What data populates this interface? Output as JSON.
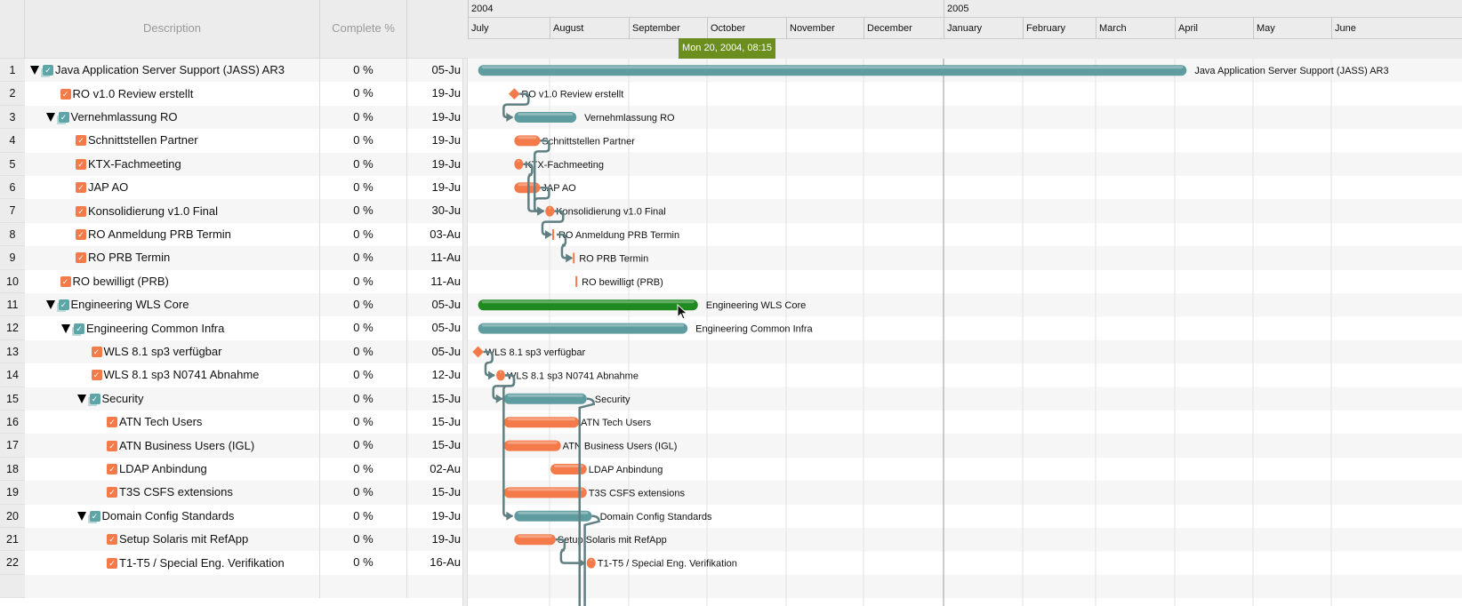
{
  "columns": {
    "description": "Description",
    "complete": "Complete %"
  },
  "timeline": {
    "years": [
      {
        "label": "2004"
      },
      {
        "label": "2005"
      }
    ],
    "months": [
      "July",
      "August",
      "September",
      "October",
      "November",
      "December",
      "January",
      "February",
      "March",
      "April",
      "May",
      "June"
    ],
    "tooltip": "Mon 20, 2004, 08:15"
  },
  "colors": {
    "group": "#5e9c9f",
    "task": "#f47a4a",
    "selected": "#1f8a1f",
    "link": "#5f7f82",
    "tooltip": "#6b8e1e"
  },
  "tasks": [
    {
      "n": "1",
      "name": "Java Application Server Support (JASS) AR3",
      "level": 0,
      "group": true,
      "pct": "0 %",
      "start_text": "05-Ju",
      "start": "2004-07-05",
      "end": "2005-04-05"
    },
    {
      "n": "2",
      "name": "RO v1.0 Review erstellt",
      "level": 1,
      "group": false,
      "pct": "0 %",
      "start_text": "19-Ju",
      "start": "2004-07-19",
      "end": "2004-07-19",
      "kind": "milestone"
    },
    {
      "n": "3",
      "name": "Vernehmlassung RO",
      "level": 1,
      "group": true,
      "pct": "0 %",
      "start_text": "19-Ju",
      "start": "2004-07-19",
      "end": "2004-08-12"
    },
    {
      "n": "4",
      "name": "Schnittstellen Partner",
      "level": 2,
      "group": false,
      "pct": "0 %",
      "start_text": "19-Ju",
      "start": "2004-07-19",
      "end": "2004-07-29"
    },
    {
      "n": "5",
      "name": "KTX-Fachmeeting",
      "level": 2,
      "group": false,
      "pct": "0 %",
      "start_text": "19-Ju",
      "start": "2004-07-19",
      "end": "2004-07-21"
    },
    {
      "n": "6",
      "name": "JAP AO",
      "level": 2,
      "group": false,
      "pct": "0 %",
      "start_text": "19-Ju",
      "start": "2004-07-19",
      "end": "2004-07-29"
    },
    {
      "n": "7",
      "name": "Konsolidierung v1.0 Final",
      "level": 2,
      "group": false,
      "pct": "0 %",
      "start_text": "30-Ju",
      "start": "2004-07-31",
      "end": "2004-08-02"
    },
    {
      "n": "8",
      "name": "RO Anmeldung PRB Termin",
      "level": 2,
      "group": false,
      "pct": "0 %",
      "start_text": "03-Au",
      "start": "2004-08-03",
      "end": "2004-08-03",
      "kind": "tick"
    },
    {
      "n": "9",
      "name": "RO PRB Termin",
      "level": 2,
      "group": false,
      "pct": "0 %",
      "start_text": "11-Au",
      "start": "2004-08-11",
      "end": "2004-08-11",
      "kind": "tick"
    },
    {
      "n": "10",
      "name": "RO bewilligt (PRB)",
      "level": 1,
      "group": false,
      "pct": "0 %",
      "start_text": "11-Au",
      "start": "2004-08-12",
      "end": "2004-08-12",
      "kind": "tick"
    },
    {
      "n": "11",
      "name": "Engineering WLS Core",
      "level": 1,
      "group": true,
      "pct": "0 %",
      "start_text": "05-Ju",
      "start": "2004-07-05",
      "end": "2004-09-28",
      "selected": true
    },
    {
      "n": "12",
      "name": "Engineering Common Infra",
      "level": 2,
      "group": true,
      "pct": "0 %",
      "start_text": "05-Ju",
      "start": "2004-07-05",
      "end": "2004-09-24"
    },
    {
      "n": "13",
      "name": "WLS 8.1 sp3 verfügbar",
      "level": 3,
      "group": false,
      "pct": "0 %",
      "start_text": "05-Ju",
      "start": "2004-07-05",
      "end": "2004-07-05",
      "kind": "milestone"
    },
    {
      "n": "14",
      "name": "WLS 8.1 sp3 N0741 Abnahme",
      "level": 3,
      "group": false,
      "pct": "0 %",
      "start_text": "12-Ju",
      "start": "2004-07-12",
      "end": "2004-07-14"
    },
    {
      "n": "15",
      "name": "Security",
      "level": 3,
      "group": true,
      "pct": "0 %",
      "start_text": "15-Ju",
      "start": "2004-07-15",
      "end": "2004-08-16"
    },
    {
      "n": "16",
      "name": "ATN Tech Users",
      "level": 4,
      "group": false,
      "pct": "0 %",
      "start_text": "15-Ju",
      "start": "2004-07-15",
      "end": "2004-08-13"
    },
    {
      "n": "17",
      "name": "ATN Business Users (IGL)",
      "level": 4,
      "group": false,
      "pct": "0 %",
      "start_text": "15-Ju",
      "start": "2004-07-15",
      "end": "2004-08-06"
    },
    {
      "n": "18",
      "name": "LDAP Anbindung",
      "level": 4,
      "group": false,
      "pct": "0 %",
      "start_text": "02-Au",
      "start": "2004-08-02",
      "end": "2004-08-16"
    },
    {
      "n": "19",
      "name": "T3S CSFS extensions",
      "level": 4,
      "group": false,
      "pct": "0 %",
      "start_text": "15-Ju",
      "start": "2004-07-15",
      "end": "2004-08-16"
    },
    {
      "n": "20",
      "name": "Domain Config Standards",
      "level": 3,
      "group": true,
      "pct": "0 %",
      "start_text": "19-Ju",
      "start": "2004-07-19",
      "end": "2004-08-18"
    },
    {
      "n": "21",
      "name": "Setup Solaris mit RefApp",
      "level": 4,
      "group": false,
      "pct": "0 %",
      "start_text": "19-Ju",
      "start": "2004-07-19",
      "end": "2004-08-04"
    },
    {
      "n": "22",
      "name": "T1-T5 / Special Eng. Verifikation",
      "level": 4,
      "group": false,
      "pct": "0 %",
      "start_text": "16-Au",
      "start": "2004-08-16",
      "end": "2004-08-17"
    }
  ],
  "dependencies": [
    [
      2,
      3
    ],
    [
      4,
      7
    ],
    [
      5,
      7
    ],
    [
      6,
      7
    ],
    [
      7,
      8
    ],
    [
      8,
      9
    ],
    [
      13,
      14
    ],
    [
      14,
      15
    ],
    [
      14,
      20
    ],
    [
      21,
      22
    ]
  ]
}
